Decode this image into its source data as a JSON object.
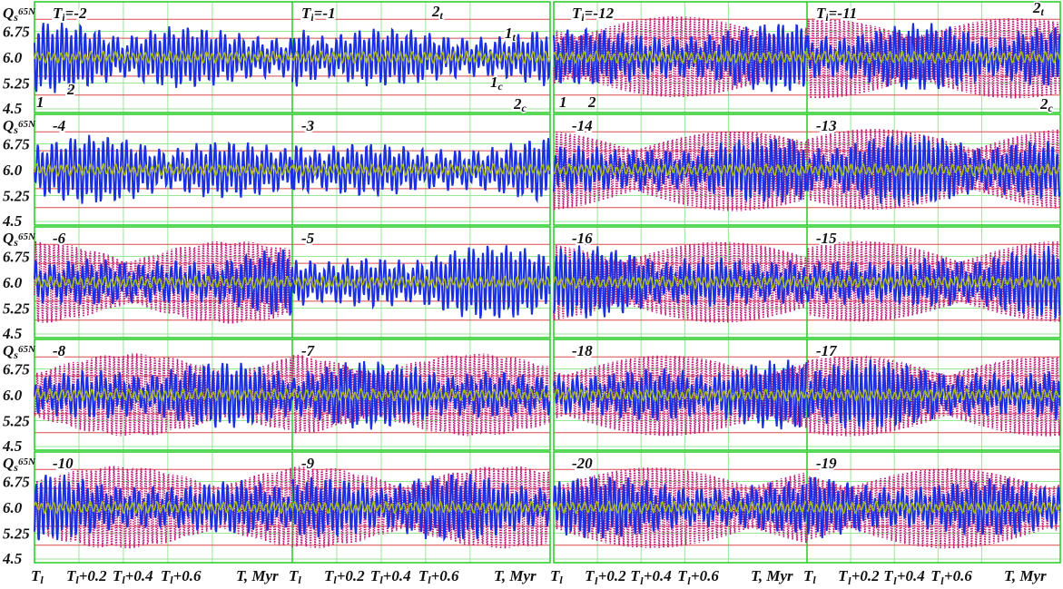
{
  "chart_data": {
    "type": "line",
    "title": "",
    "ylabel": {
      "main": "Q",
      "sub": "s",
      "sup": "65N"
    },
    "xlabel": "T, Myr",
    "y_ticks": [
      "6.75",
      "6.0",
      "5.25",
      "4.5"
    ],
    "y_tick_values": [
      6.75,
      6.0,
      5.25,
      4.5
    ],
    "ylim": [
      4.5,
      7.5
    ],
    "red_reference_levels": [
      7.1,
      6.55,
      6.0,
      5.45,
      4.9
    ],
    "x_ticks": [
      "T",
      "T +0.2",
      "T +0.4",
      "T +0.6",
      "T, Myr"
    ],
    "x_tick_parts": [
      {
        "main": "T",
        "sub": "l",
        "rest": ""
      },
      {
        "main": "T",
        "sub": "l",
        "rest": "+0.2"
      },
      {
        "main": "T",
        "sub": "l",
        "rest": "+0.4"
      },
      {
        "main": "T",
        "sub": "l",
        "rest": "+0.6"
      },
      {
        "main": "T, Myr",
        "sub": "",
        "rest": ""
      }
    ],
    "x_range_myr": [
      0,
      1.0
    ],
    "panel_prefix": {
      "main": "T",
      "sub": "l",
      "eq": "="
    },
    "series": [
      {
        "name": "1",
        "description": "insolation curve 1",
        "color": "#1a2fe0",
        "style": "solid"
      },
      {
        "name": "2",
        "description": "curve 2",
        "color": "#a6b81e",
        "style": "solid"
      },
      {
        "name": "1t",
        "color": "#c0187a",
        "style": "dotted"
      },
      {
        "name": "2t",
        "color": "#c0187a",
        "style": "dotted"
      }
    ],
    "mean_level": 6.0,
    "dominant_period_myr": 0.021,
    "panels": [
      {
        "value": "-2",
        "prefixed": true,
        "block": "left",
        "half": 0,
        "row": 0,
        "dotted": false,
        "amp": 0.9,
        "seed": 3
      },
      {
        "value": "-1",
        "prefixed": true,
        "block": "left",
        "half": 1,
        "row": 0,
        "dotted": false,
        "amp": 0.9,
        "seed": 5
      },
      {
        "value": "-12",
        "prefixed": true,
        "block": "right",
        "half": 0,
        "row": 0,
        "dotted": true,
        "amp": 0.95,
        "seed": 7
      },
      {
        "value": "-11",
        "prefixed": true,
        "block": "right",
        "half": 1,
        "row": 0,
        "dotted": true,
        "amp": 0.85,
        "seed": 11
      },
      {
        "value": "-4",
        "prefixed": false,
        "block": "left",
        "half": 0,
        "row": 1,
        "dotted": false,
        "amp": 0.85,
        "seed": 13
      },
      {
        "value": "-3",
        "prefixed": false,
        "block": "left",
        "half": 1,
        "row": 1,
        "dotted": false,
        "amp": 0.9,
        "seed": 17
      },
      {
        "value": "-14",
        "prefixed": false,
        "block": "right",
        "half": 0,
        "row": 1,
        "dotted": true,
        "amp": 0.85,
        "seed": 19
      },
      {
        "value": "-13",
        "prefixed": false,
        "block": "right",
        "half": 1,
        "row": 1,
        "dotted": true,
        "amp": 0.9,
        "seed": 23
      },
      {
        "value": "-6",
        "prefixed": false,
        "block": "left",
        "half": 0,
        "row": 2,
        "dotted": true,
        "amp": 0.85,
        "seed": 29
      },
      {
        "value": "-5",
        "prefixed": false,
        "block": "left",
        "half": 1,
        "row": 2,
        "dotted": false,
        "amp": 0.95,
        "seed": 31
      },
      {
        "value": "-16",
        "prefixed": false,
        "block": "right",
        "half": 0,
        "row": 2,
        "dotted": true,
        "amp": 0.9,
        "seed": 37
      },
      {
        "value": "-15",
        "prefixed": false,
        "block": "right",
        "half": 1,
        "row": 2,
        "dotted": true,
        "amp": 0.9,
        "seed": 41
      },
      {
        "value": "-8",
        "prefixed": false,
        "block": "left",
        "half": 0,
        "row": 3,
        "dotted": true,
        "amp": 0.8,
        "seed": 43
      },
      {
        "value": "-7",
        "prefixed": false,
        "block": "left",
        "half": 1,
        "row": 3,
        "dotted": true,
        "amp": 0.85,
        "seed": 47
      },
      {
        "value": "-18",
        "prefixed": false,
        "block": "right",
        "half": 0,
        "row": 3,
        "dotted": true,
        "amp": 0.85,
        "seed": 53
      },
      {
        "value": "-17",
        "prefixed": false,
        "block": "right",
        "half": 1,
        "row": 3,
        "dotted": true,
        "amp": 0.9,
        "seed": 59
      },
      {
        "value": "-10",
        "prefixed": false,
        "block": "left",
        "half": 0,
        "row": 4,
        "dotted": true,
        "amp": 0.9,
        "seed": 61
      },
      {
        "value": "-9",
        "prefixed": false,
        "block": "left",
        "half": 1,
        "row": 4,
        "dotted": true,
        "amp": 0.85,
        "seed": 67
      },
      {
        "value": "-20",
        "prefixed": false,
        "block": "right",
        "half": 0,
        "row": 4,
        "dotted": true,
        "amp": 0.85,
        "seed": 71
      },
      {
        "value": "-19",
        "prefixed": false,
        "block": "right",
        "half": 1,
        "row": 4,
        "dotted": true,
        "amp": 0.9,
        "seed": 73
      }
    ],
    "annotations": [
      {
        "text": "1",
        "sub": "",
        "block": "left"
      },
      {
        "text": "2",
        "sub": "",
        "block": "left"
      },
      {
        "text": "2",
        "sub": "t",
        "block": "left"
      },
      {
        "text": "1",
        "sub": "t",
        "block": "left"
      },
      {
        "text": "1",
        "sub": "c",
        "block": "left"
      },
      {
        "text": "2",
        "sub": "c",
        "block": "left"
      },
      {
        "text": "1",
        "sub": "",
        "block": "right"
      },
      {
        "text": "2",
        "sub": "",
        "block": "right"
      },
      {
        "text": "2",
        "sub": "t",
        "block": "right"
      },
      {
        "text": "2",
        "sub": "c",
        "block": "right"
      }
    ],
    "colors": {
      "frame": "#22cc22",
      "grid": "#99e699",
      "reference": "#d94a4a",
      "curve1": "#1a2fe0",
      "curve2": "#a6b81e",
      "dotted": "#c0187a"
    }
  }
}
